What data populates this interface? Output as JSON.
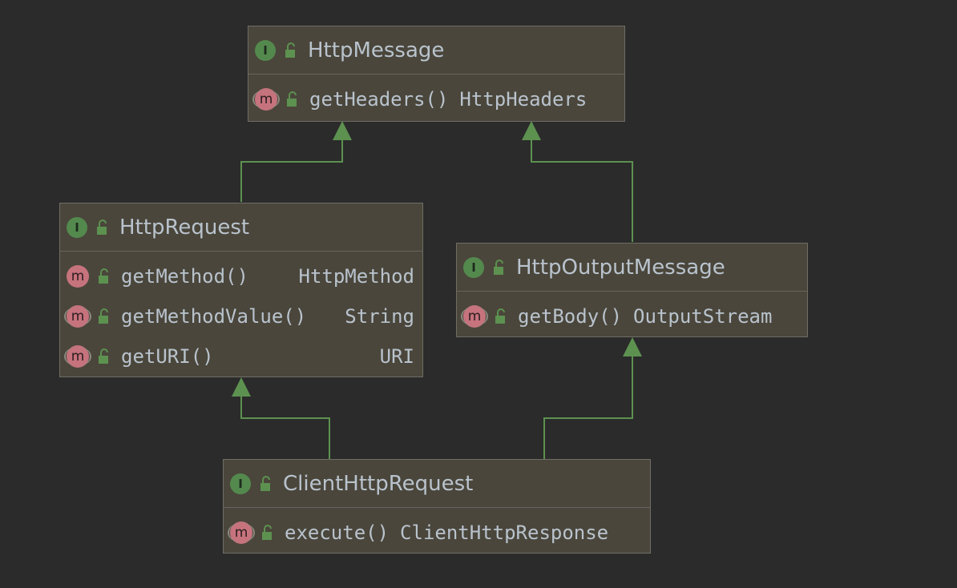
{
  "colors": {
    "background": "#2b2b2b",
    "node_fill": "#4a463b",
    "edge": "#5d9150",
    "interface_badge": "#54894e",
    "method_badge": "#c6737d",
    "text": "#b9c3cd"
  },
  "nodes": {
    "http_message": {
      "title": "HttpMessage",
      "kind": "interface",
      "members": [
        {
          "name": "getHeaders()",
          "type": "HttpHeaders"
        }
      ]
    },
    "http_request": {
      "title": "HttpRequest",
      "kind": "interface",
      "members": [
        {
          "name": "getMethod()",
          "type": "HttpMethod"
        },
        {
          "name": "getMethodValue()",
          "type": "String"
        },
        {
          "name": "getURI()",
          "type": "URI"
        }
      ]
    },
    "http_output_message": {
      "title": "HttpOutputMessage",
      "kind": "interface",
      "members": [
        {
          "name": "getBody()",
          "type": "OutputStream"
        }
      ]
    },
    "client_http_request": {
      "title": "ClientHttpRequest",
      "kind": "interface",
      "members": [
        {
          "name": "execute()",
          "type": "ClientHttpResponse"
        }
      ]
    }
  },
  "edges": [
    {
      "from": "http_request",
      "to": "http_message",
      "relation": "extends"
    },
    {
      "from": "http_output_message",
      "to": "http_message",
      "relation": "extends"
    },
    {
      "from": "client_http_request",
      "to": "http_request",
      "relation": "extends"
    },
    {
      "from": "client_http_request",
      "to": "http_output_message",
      "relation": "extends"
    }
  ]
}
